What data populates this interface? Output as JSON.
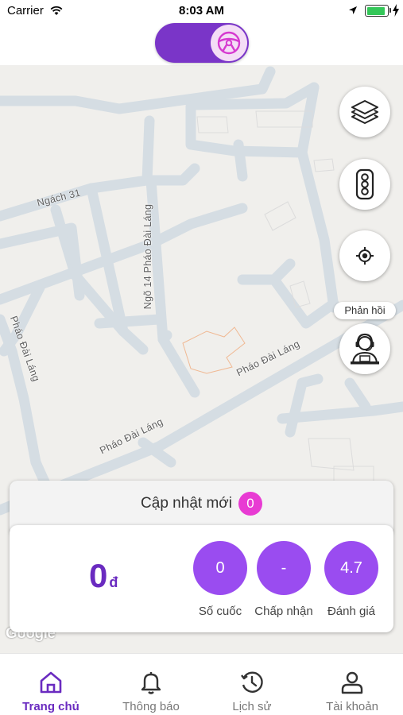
{
  "status_bar": {
    "carrier": "Carrier",
    "time": "8:03 AM",
    "battery_color": "#34c759"
  },
  "header": {
    "toggle_icon": "steering-wheel-icon",
    "toggle_color": "#7a35c8"
  },
  "map": {
    "streets": [
      "Ngách 31",
      "Ngõ 14 Pháo Đài Láng",
      "Pháo Đài Láng",
      "Pháo Đài Láng",
      "Pháo Đài Láng",
      "Pháo Đài Láng"
    ],
    "buttons": {
      "layers_icon": "layers-icon",
      "traffic_icon": "traffic-light-icon",
      "locate_icon": "locate-icon",
      "support_icon": "support-agent-icon"
    },
    "feedback_label": "Phản hồi",
    "attribution": "Google"
  },
  "update_card": {
    "title": "Cập nhật mới",
    "badge_count": "0",
    "badge_color": "#e83bd3"
  },
  "stats": {
    "earnings_value": "0",
    "earnings_unit": "đ",
    "items": [
      {
        "value": "0",
        "label": "Số cuốc"
      },
      {
        "value": "-",
        "label": "Chấp nhận"
      },
      {
        "value": "4.7",
        "label": "Đánh giá"
      }
    ],
    "accent_color": "#9a4cf0"
  },
  "tab_bar": {
    "tabs": [
      {
        "label": "Trang chủ",
        "icon": "home-icon",
        "active": true
      },
      {
        "label": "Thông báo",
        "icon": "bell-icon",
        "active": false
      },
      {
        "label": "Lịch sử",
        "icon": "history-icon",
        "active": false
      },
      {
        "label": "Tài khoản",
        "icon": "account-icon",
        "active": false
      }
    ],
    "active_color": "#6a2bc0"
  }
}
